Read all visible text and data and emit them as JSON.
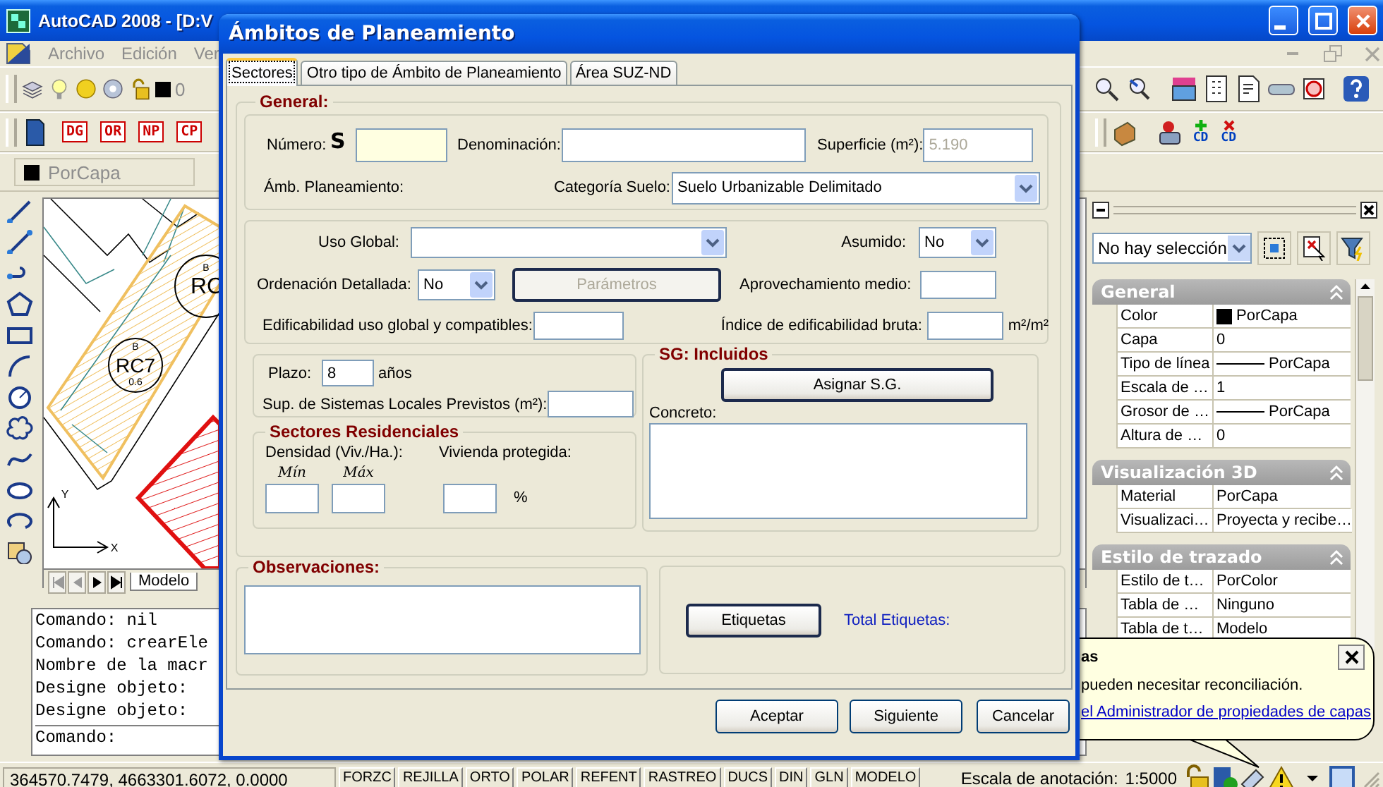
{
  "app": {
    "title": "AutoCAD 2008 - [D:V",
    "menu": [
      {
        "label": "Archivo",
        "disabled": true
      },
      {
        "label": "Edición",
        "disabled": true
      },
      {
        "label": "Ver",
        "disabled": true
      }
    ],
    "layer": "0",
    "macro_buttons": [
      "DG",
      "OR",
      "NP",
      "CP"
    ],
    "cd_buttons": [
      {
        "kind": "add",
        "label": "CD"
      },
      {
        "kind": "remove",
        "label": "CD"
      }
    ],
    "color_combo": "PorCapa",
    "drawing": {
      "plots": [
        {
          "zone": "B",
          "code": "RC"
        },
        {
          "zone": "B",
          "code": "RC7",
          "ratio": "0.6"
        }
      ],
      "ucs_labels": [
        "X",
        "Y"
      ]
    },
    "layout_tabs": [
      {
        "label": "Modelo",
        "selected": true
      }
    ],
    "command_history": [
      "Comando: nil",
      "Comando: crearEle",
      "Nombre de la macr",
      "Designe objeto:",
      "Designe objeto:"
    ],
    "command_prompt": "Comando:",
    "status": {
      "coordinates": "364570.7479, 4663301.6072, 0.0000",
      "toggles": [
        "FORZC",
        "REJILLA",
        "ORTO",
        "POLAR",
        "REFENT",
        "RASTREO",
        "DUCS",
        "DIN",
        "GLN",
        "MODELO"
      ],
      "scale_label": "Escala de anotación:",
      "scale": "1:5000"
    }
  },
  "properties": {
    "selection": "No hay selección",
    "sections": [
      {
        "title": "General",
        "expanded": true,
        "rows": [
          {
            "kind": "color",
            "name": "Color",
            "value": "PorCapa"
          },
          {
            "kind": "text",
            "name": "Capa",
            "value": "0"
          },
          {
            "kind": "linetype",
            "name": "Tipo de línea",
            "value": "PorCapa"
          },
          {
            "kind": "text",
            "name": "Escala de …",
            "value": "1"
          },
          {
            "kind": "linetype",
            "name": "Grosor de …",
            "value": "PorCapa"
          },
          {
            "kind": "text",
            "name": "Altura de …",
            "value": "0"
          }
        ]
      },
      {
        "title": "Visualización 3D",
        "expanded": true,
        "rows": [
          {
            "kind": "text",
            "name": "Material",
            "value": "PorCapa"
          },
          {
            "kind": "text",
            "name": "Visualizaci…",
            "value": "Proyecta y recibe…"
          }
        ]
      },
      {
        "title": "Estilo de trazado",
        "expanded": true,
        "rows": [
          {
            "kind": "text",
            "name": "Estilo de t…",
            "value": "PorColor"
          },
          {
            "kind": "text",
            "name": "Tabla de …",
            "value": "Ninguno"
          },
          {
            "kind": "text",
            "name": "Tabla de t…",
            "value": "Modelo"
          }
        ]
      }
    ]
  },
  "balloon": {
    "title": "as",
    "message": "pueden necesitar reconciliación.",
    "link": "el Administrador de propiedades de capas"
  },
  "dialog": {
    "title": "Ámbitos de Planeamiento",
    "tabs": [
      {
        "label": "Sectores",
        "selected": true
      },
      {
        "label": "Otro tipo de Ámbito de Planeamiento",
        "selected": false
      },
      {
        "label": "Área SUZ-ND",
        "selected": false
      }
    ],
    "general_title": "General:",
    "numero": {
      "label": "Número:",
      "prefix": "S"
    },
    "denominacion": {
      "label": "Denominación:"
    },
    "superficie": {
      "label": "Superficie (m²):",
      "value": "5.190",
      "disabled": true
    },
    "ambito_label": "Ámb. Planeamiento:",
    "categoria": {
      "label": "Categoría Suelo:",
      "value": "Suelo Urbanizable Delimitado"
    },
    "uso_global": {
      "label": "Uso Global:"
    },
    "asumido": {
      "label": "Asumido:",
      "value": "No"
    },
    "ordenacion": {
      "label": "Ordenación Detallada:",
      "value": "No"
    },
    "parametros_button": {
      "label": "Parámetros",
      "disabled": true
    },
    "aprovechamiento": {
      "label": "Aprovechamiento medio:"
    },
    "edificabilidad": {
      "label": "Edificabilidad uso global y compatibles:"
    },
    "indice": {
      "label": "Índice de edificabilidad bruta:",
      "unit": "m²/m²"
    },
    "plazo": {
      "label": "Plazo:",
      "value": "8",
      "unit": "años"
    },
    "sup_sistemas": {
      "label": "Sup. de Sistemas Locales Previstos (m²):"
    },
    "residenciales": {
      "title": "Sectores Residenciales",
      "densidad_label": "Densidad (Viv./Ha.):",
      "vivienda_label": "Vivienda protegida:",
      "min_label": "Mín",
      "max_label": "Máx",
      "percent": "%"
    },
    "sg": {
      "title": "SG: Incluidos",
      "button": "Asignar S.G.",
      "concreto_label": "Concreto:"
    },
    "observaciones_title": "Observaciones:",
    "etiquetas_button": "Etiquetas",
    "total_etiquetas": "Total Etiquetas:",
    "buttons": [
      "Aceptar",
      "Siguiente",
      "Cancelar"
    ]
  }
}
